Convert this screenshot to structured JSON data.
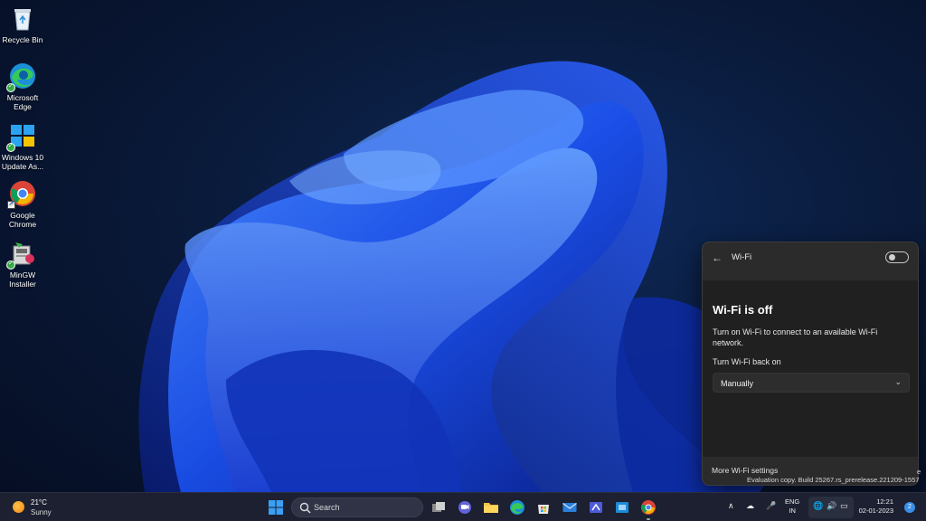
{
  "desktop": {
    "icons": [
      {
        "label": "Recycle Bin"
      },
      {
        "label": "Microsoft Edge"
      },
      {
        "label": "Windows 10 Update As..."
      },
      {
        "label": "Google Chrome"
      },
      {
        "label": "MinGW Installer"
      }
    ]
  },
  "wifi_panel": {
    "title": "Wi-Fi",
    "toggle_state": "off",
    "heading": "Wi-Fi is off",
    "description": "Turn on Wi-Fi to connect to an available Wi-Fi network.",
    "turn_back_label": "Turn Wi-Fi back on",
    "turn_back_value": "Manually",
    "more_settings": "More Wi-Fi settings"
  },
  "watermark": {
    "line": "Evaluation copy. Build 25267.rs_prerelease.221209-1557",
    "line_top": "e"
  },
  "taskbar": {
    "weather": {
      "temp": "21°C",
      "condition": "Sunny"
    },
    "search_label": "Search",
    "language": {
      "line1": "ENG",
      "line2": "IN"
    },
    "clock": {
      "time": "12:21",
      "date": "02-01-2023"
    },
    "notification_count": "2",
    "accent_color": "#3a8ee6"
  }
}
